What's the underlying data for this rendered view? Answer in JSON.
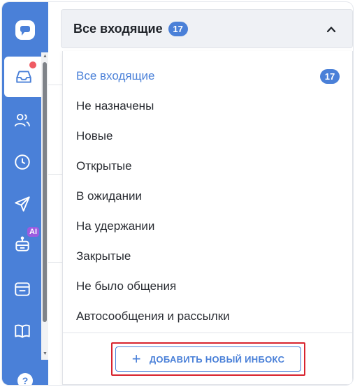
{
  "colors": {
    "accent": "#4a80d8",
    "notification": "#ef5b63",
    "highlight_border": "#d8232e",
    "ai_badge": "#9c5ce0"
  },
  "sidebar": {
    "items": [
      {
        "icon": "chat-logo-icon"
      },
      {
        "icon": "inbox-icon",
        "active": true,
        "has_notification": true
      },
      {
        "icon": "users-icon"
      },
      {
        "icon": "clock-icon"
      },
      {
        "icon": "send-icon"
      },
      {
        "icon": "bot-icon",
        "badge": "AI"
      },
      {
        "icon": "wallet-icon"
      },
      {
        "icon": "book-icon"
      },
      {
        "icon": "help-icon",
        "label": "?"
      }
    ]
  },
  "inbox_select": {
    "title": "Все входящие",
    "count": "17"
  },
  "menu": {
    "items": [
      {
        "label": "Все входящие",
        "count": "17",
        "selected": true
      },
      {
        "label": "Не назначены"
      },
      {
        "label": "Новые"
      },
      {
        "label": "Открытые"
      },
      {
        "label": "В ожидании"
      },
      {
        "label": "На удержании"
      },
      {
        "label": "Закрытые"
      },
      {
        "label": "Не было общения"
      },
      {
        "label": "Автосообщения и рассылки"
      }
    ],
    "add_button": {
      "plus": "+",
      "label": "ДОБАВИТЬ НОВЫЙ ИНБОКС"
    }
  }
}
